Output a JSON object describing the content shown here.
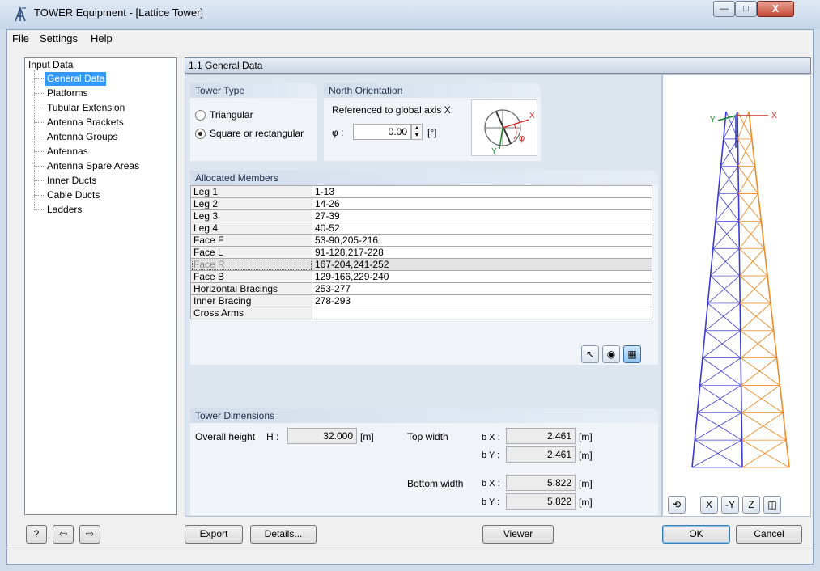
{
  "window": {
    "title": "TOWER Equipment - [Lattice Tower]",
    "close_glyph": "X"
  },
  "menu": [
    {
      "label": "File"
    },
    {
      "label": "Settings"
    },
    {
      "label": "Help"
    }
  ],
  "tree": {
    "root": "Input Data",
    "items": [
      {
        "label": "General Data",
        "selected": true
      },
      {
        "label": "Platforms"
      },
      {
        "label": "Tubular Extension"
      },
      {
        "label": "Antenna Brackets"
      },
      {
        "label": "Antenna Groups"
      },
      {
        "label": "Antennas"
      },
      {
        "label": "Antenna Spare Areas"
      },
      {
        "label": "Inner Ducts"
      },
      {
        "label": "Cable Ducts"
      },
      {
        "label": "Ladders"
      }
    ]
  },
  "panel": {
    "title": "1.1 General Data"
  },
  "tower_type": {
    "title": "Tower Type",
    "options": [
      {
        "label": "Triangular",
        "checked": false
      },
      {
        "label": "Square or rectangular",
        "checked": true
      }
    ]
  },
  "north": {
    "title": "North Orientation",
    "ref_label": "Referenced to global axis X:",
    "phi_label": "φ :",
    "phi_value": "0.00",
    "phi_unit": "[°]",
    "img_x": "X",
    "img_y": "Y",
    "img_phi": "φ"
  },
  "members": {
    "title": "Allocated Members",
    "rows": [
      {
        "name": "Leg 1",
        "value": "1-13"
      },
      {
        "name": "Leg 2",
        "value": "14-26"
      },
      {
        "name": "Leg 3",
        "value": "27-39"
      },
      {
        "name": "Leg 4",
        "value": "40-52"
      },
      {
        "name": "Face F",
        "value": "53-90,205-216"
      },
      {
        "name": "Face L",
        "value": "91-128,217-228"
      },
      {
        "name": "Face R",
        "value": "167-204,241-252",
        "disabled": true
      },
      {
        "name": "Face B",
        "value": "129-166,229-240"
      },
      {
        "name": "Horizontal Bracings",
        "value": "253-277"
      },
      {
        "name": "Inner Bracing",
        "value": "278-293"
      },
      {
        "name": "Cross Arms",
        "value": ""
      }
    ]
  },
  "dimensions": {
    "title": "Tower Dimensions",
    "overall_height_label": "Overall height",
    "h_symbol": "H :",
    "overall_height_value": "32.000",
    "unit_m": "[m]",
    "top_width_label": "Top width",
    "bottom_width_label": "Bottom width",
    "bx_symbol": "b X :",
    "by_symbol": "b Y :",
    "top_bx": "2.461",
    "top_by": "2.461",
    "bottom_bx": "5.822",
    "bottom_by": "5.822"
  },
  "viewer": {
    "axis_x": "X",
    "axis_y": "Y"
  },
  "buttons": {
    "export": "Export",
    "details": "Details...",
    "viewer": "Viewer",
    "ok": "OK",
    "cancel": "Cancel"
  },
  "colors": {
    "selection": "#3399ff",
    "tower_blue": "#3a3ad8",
    "tower_orange": "#f08a24"
  }
}
